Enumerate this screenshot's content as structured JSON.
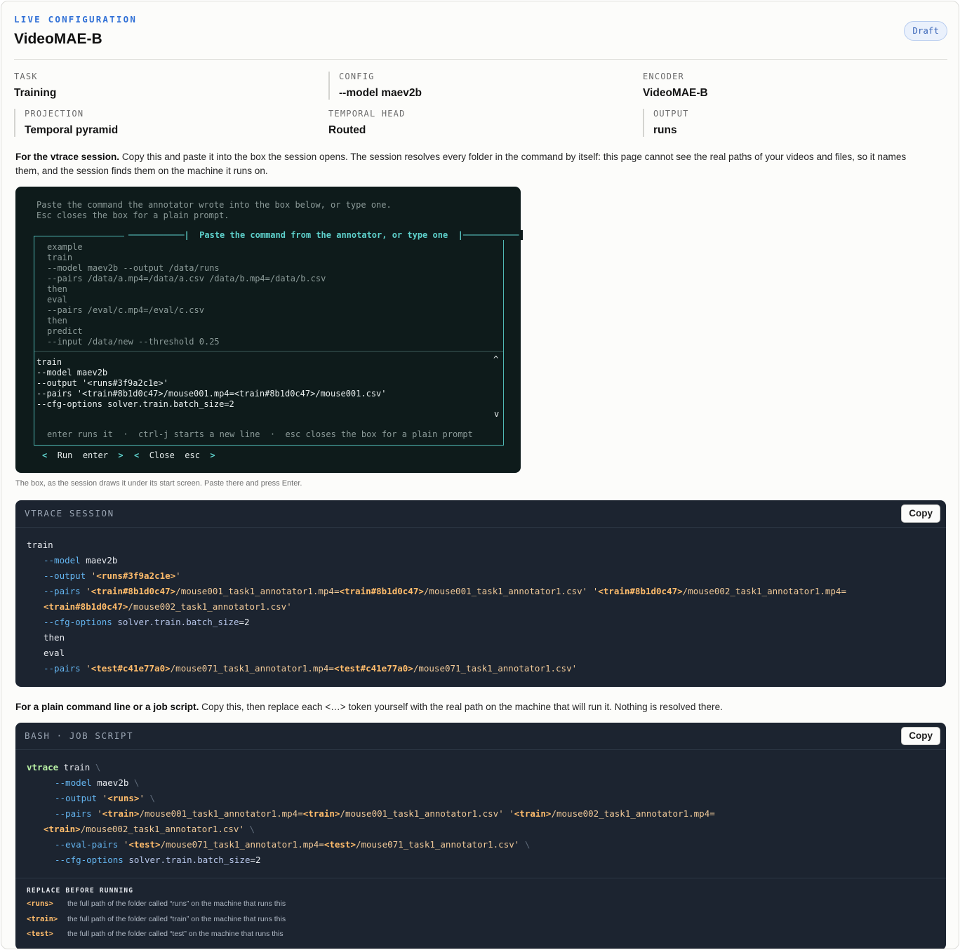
{
  "header": {
    "eyebrow": "LIVE CONFIGURATION",
    "title": "VideoMAE-B",
    "badge": "Draft"
  },
  "fields": [
    {
      "label": "TASK",
      "value": "Training"
    },
    {
      "label": "CONFIG",
      "value": "--model maev2b"
    },
    {
      "label": "ENCODER",
      "value": "VideoMAE-B"
    },
    {
      "label": "PROJECTION",
      "value": "Temporal pyramid"
    },
    {
      "label": "TEMPORAL HEAD",
      "value": "Routed"
    },
    {
      "label": "OUTPUT",
      "value": "runs"
    }
  ],
  "intro": {
    "bold": "For the vtrace session.",
    "text": " Copy this and paste it into the box the session opens. The session resolves every folder in the command by itself: this page cannot see the real paths of your videos and files, so it names them, and the session finds them on the machine it runs on."
  },
  "terminal": {
    "intro_lines": [
      "Paste the command the annotator wrote into the box below, or type one.",
      "Esc closes the box for a plain prompt."
    ],
    "box_title": "Paste the command from the annotator, or type one",
    "example_lines": [
      "example",
      "train",
      "--model maev2b --output /data/runs",
      "--pairs /data/a.mp4=/data/a.csv /data/b.mp4=/data/b.csv",
      "then",
      "eval",
      "--pairs /eval/c.mp4=/eval/c.csv",
      "then",
      "predict",
      "--input /data/new --threshold 0.25"
    ],
    "input_lines": [
      "train",
      "--model maev2b",
      "--output '<runs#3f9a2c1e>'",
      "--pairs '<train#8b1d0c47>/mouse001.mp4=<train#8b1d0c47>/mouse001.csv'",
      "--cfg-options solver.train.batch_size=2"
    ],
    "scroll_up": "^",
    "scroll_down": "v",
    "hint": "enter runs it  ·  ctrl-j starts a new line  ·  esc closes the box for a plain prompt",
    "run_label": "Run",
    "run_key": "enter",
    "close_label": "Close",
    "close_key": "esc"
  },
  "caption": "The box, as the session draws it under its start screen. Paste there and press Enter.",
  "session_block": {
    "label": "VTRACE SESSION",
    "copy_label": "Copy"
  },
  "plain": {
    "bold": "For a plain command line or a job script.",
    "text": " Copy this, then replace each <…> token yourself with the real path on the machine that will run it. Nothing is resolved there."
  },
  "bash_block": {
    "label": "BASH · JOB SCRIPT",
    "copy_label": "Copy"
  },
  "replace": {
    "heading": "REPLACE BEFORE RUNNING",
    "items": [
      {
        "token": "<runs>",
        "desc": "the full path of the folder called “runs” on the machine that runs this"
      },
      {
        "token": "<train>",
        "desc": "the full path of the folder called “train” on the machine that runs this"
      },
      {
        "token": "<test>",
        "desc": "the full path of the folder called “test” on the machine that runs this"
      }
    ]
  },
  "colors": {
    "accent": "#2f6fd6",
    "term_bg": "#0e1b1b",
    "term_accent": "#5ed1cc",
    "code_bg": "#1c2430",
    "token": "#ffbc6b",
    "flag": "#64b5f0"
  }
}
